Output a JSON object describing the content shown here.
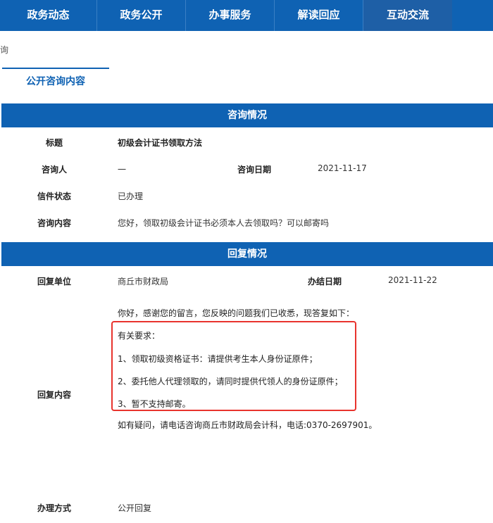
{
  "nav": {
    "items": [
      "政务动态",
      "政务公开",
      "办事服务",
      "解读回应",
      "互动交流"
    ]
  },
  "breadcrumb": "询",
  "tab_label": "公开咨询内容",
  "consult": {
    "header": "咨询情况",
    "title_label": "标题",
    "title_value": "初级会计证书领取方法",
    "person_label": "咨询人",
    "person_value": "一",
    "date_label": "咨询日期",
    "date_value": "2021-11-17",
    "status_label": "信件状态",
    "status_value": "已办理",
    "content_label": "咨询内容",
    "content_value": "您好，领取初级会计证书必须本人去领取吗？可以邮寄吗"
  },
  "reply": {
    "header": "回复情况",
    "unit_label": "回复单位",
    "unit_value": "商丘市财政局",
    "done_date_label": "办结日期",
    "done_date_value": "2021-11-22",
    "content_label": "回复内容",
    "lines": [
      "你好，感谢您的留言，您反映的问题我们已收悉，现答复如下：",
      "有关要求：",
      "1、领取初级资格证书：请提供考生本人身份证原件；",
      "2、委托他人代理领取的，请同时提供代领人的身份证原件；",
      "3、暂不支持邮寄。",
      "如有疑问，请电话咨询商丘市财政局会计科，电话:0370-2697901。"
    ],
    "method_label": "办理方式",
    "method_value": "公开回复"
  },
  "colors": {
    "primary": "#0f62b3",
    "highlight_box": "#e8332d"
  }
}
